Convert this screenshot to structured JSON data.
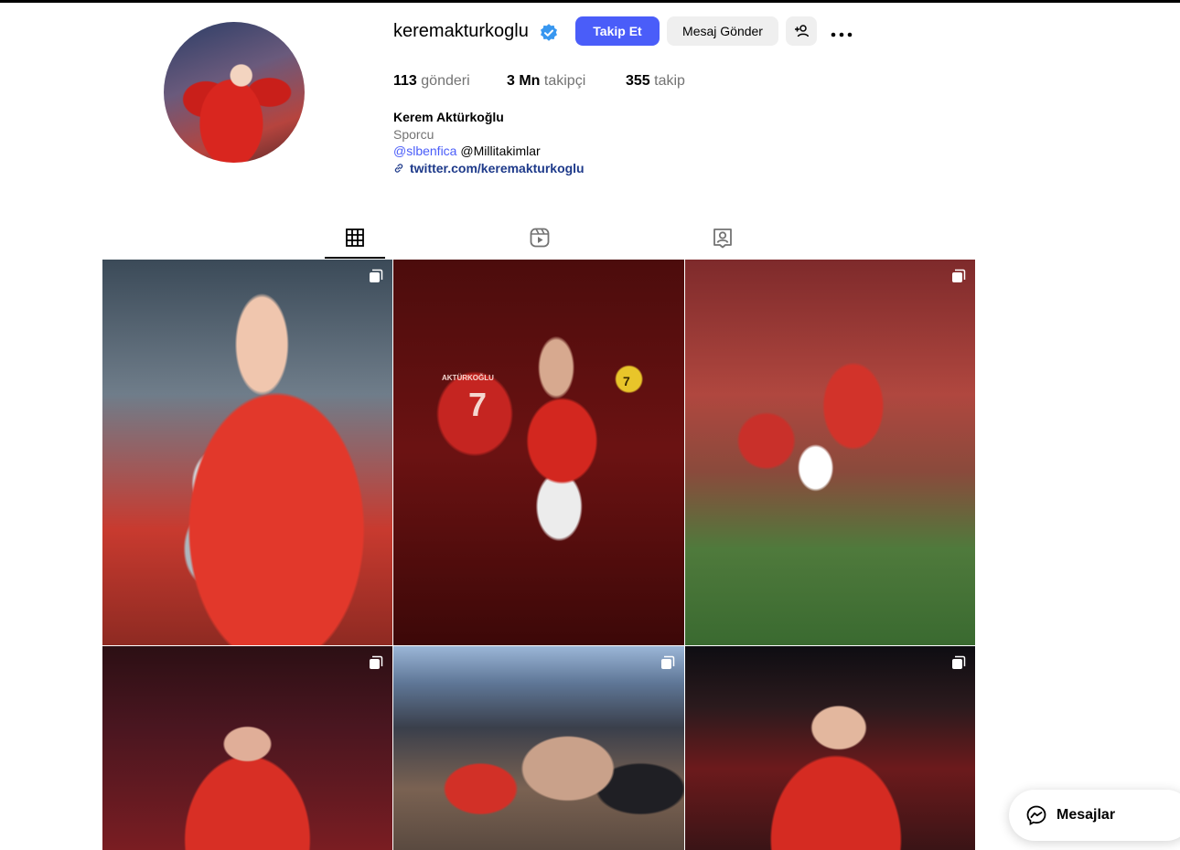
{
  "profile": {
    "username": "keremakturkoglu",
    "follow_label": "Takip Et",
    "message_label": "Mesaj Gönder",
    "stats": {
      "posts_value": "113",
      "posts_label": "gönderi",
      "followers_value": "3 Mn",
      "followers_label": "takipçi",
      "following_value": "355",
      "following_label": "takip"
    },
    "bio": {
      "name": "Kerem Aktürkoğlu",
      "category": "Sporcu",
      "mention1": "@slbenfica",
      "mention2": "@Millitakimlar",
      "link": "twitter.com/keremakturkoglu"
    }
  },
  "tabs": [
    "posts",
    "reels",
    "tagged"
  ],
  "posts": {
    "post2_jersey_name": "AKTÜRKOĞLU",
    "post2_jersey_number": "7",
    "post2_ball_number": "7"
  },
  "floating": {
    "messages_label": "Mesajlar"
  },
  "colors": {
    "primary_button": "#4a5df9",
    "secondary_button": "#efefef",
    "verified": "#3897f0",
    "muted_text": "#737373"
  }
}
